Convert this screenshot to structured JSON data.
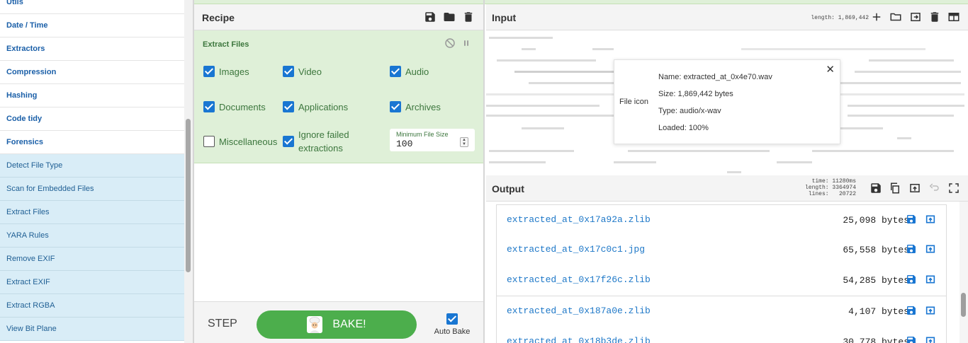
{
  "operations": {
    "categories": [
      "Utils",
      "Date / Time",
      "Extractors",
      "Compression",
      "Hashing",
      "Code tidy",
      "Forensics"
    ],
    "forensics_ops": [
      "Detect File Type",
      "Scan for Embedded Files",
      "Extract Files",
      "YARA Rules",
      "Remove EXIF",
      "Extract EXIF",
      "Extract RGBA",
      "View Bit Plane"
    ]
  },
  "recipe": {
    "title": "Recipe",
    "save_icon": "save-icon",
    "load_icon": "folder-icon",
    "clear_icon": "trash-icon",
    "operation": {
      "name": "Extract Files",
      "options": {
        "images": {
          "label": "Images",
          "checked": true
        },
        "video": {
          "label": "Video",
          "checked": true
        },
        "audio": {
          "label": "Audio",
          "checked": true
        },
        "documents": {
          "label": "Documents",
          "checked": true
        },
        "applications": {
          "label": "Applications",
          "checked": true
        },
        "archives": {
          "label": "Archives",
          "checked": true
        },
        "miscellaneous": {
          "label": "Miscellaneous",
          "checked": false
        },
        "ignore_failed": {
          "label_line1": "Ignore failed",
          "label_line2": "extractions",
          "checked": true
        }
      },
      "min_file_size": {
        "label": "Minimum File Size",
        "value": "100"
      }
    },
    "step_label": "STEP",
    "bake_label": "BAKE!",
    "auto_bake": {
      "label": "Auto Bake",
      "checked": true
    }
  },
  "input": {
    "title": "Input",
    "length_label": "length: 1,869,442",
    "file_popup": {
      "icon_label": "File icon",
      "name": "Name: extracted_at_0x4e70.wav",
      "size": "Size: 1,869,442 bytes",
      "type": "Type: audio/x-wav",
      "loaded": "Loaded: 100%",
      "close": "✕"
    }
  },
  "output": {
    "title": "Output",
    "time": "time: 11280ms",
    "length": "length: 3364974",
    "lines": "lines:   20722",
    "files": [
      {
        "name": "extracted_at_0x17a92a.zlib",
        "size": "25,098 bytes"
      },
      {
        "name": "extracted_at_0x17c0c1.jpg",
        "size": "65,558 bytes"
      },
      {
        "name": "extracted_at_0x17f26c.zlib",
        "size": "54,285 bytes"
      },
      {
        "name": "extracted_at_0x187a0e.zlib",
        "size": "4,107 bytes"
      },
      {
        "name": "extracted_at_0x18b3de.zlib",
        "size": "30,778 bytes"
      }
    ]
  },
  "colors": {
    "accent": "#1976d2",
    "bake": "#4cae4c",
    "op_bg": "#dff0d8",
    "ops_highlight": "#d9edf7"
  }
}
